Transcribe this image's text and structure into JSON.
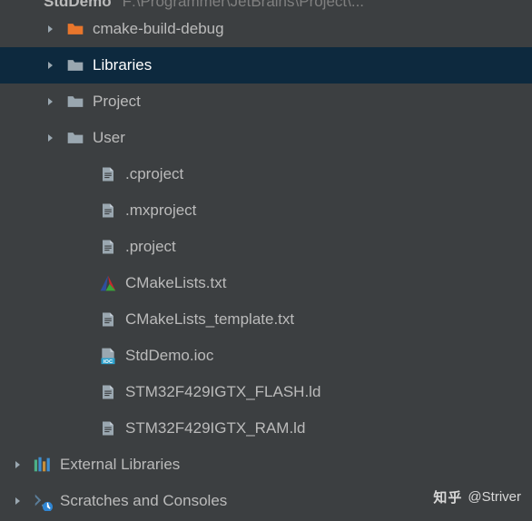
{
  "root": {
    "name": "StdDemo",
    "path": "F:\\Programmer\\JetBrains\\Project\\..."
  },
  "tree": [
    {
      "label": "cmake-build-debug",
      "icon": "folder-orange",
      "indent": 1,
      "chevron": true
    },
    {
      "label": "Libraries",
      "icon": "folder-gray",
      "indent": 1,
      "chevron": true,
      "selected": true
    },
    {
      "label": "Project",
      "icon": "folder-gray",
      "indent": 1,
      "chevron": true
    },
    {
      "label": "User",
      "icon": "folder-gray",
      "indent": 1,
      "chevron": true
    },
    {
      "label": ".cproject",
      "icon": "file-text",
      "indent": 2
    },
    {
      "label": ".mxproject",
      "icon": "file-text",
      "indent": 2
    },
    {
      "label": ".project",
      "icon": "file-text",
      "indent": 2
    },
    {
      "label": "CMakeLists.txt",
      "icon": "cmake",
      "indent": 2
    },
    {
      "label": "CMakeLists_template.txt",
      "icon": "file-text",
      "indent": 2
    },
    {
      "label": "StdDemo.ioc",
      "icon": "ioc",
      "indent": 2
    },
    {
      "label": "STM32F429IGTX_FLASH.ld",
      "icon": "file-text",
      "indent": 2
    },
    {
      "label": "STM32F429IGTX_RAM.ld",
      "icon": "file-text",
      "indent": 2
    },
    {
      "label": "External Libraries",
      "icon": "ext-lib",
      "indent": 0,
      "chevron": true
    },
    {
      "label": "Scratches and Consoles",
      "icon": "scratches",
      "indent": 0,
      "chevron": true
    }
  ],
  "watermark": {
    "site": "知乎",
    "user": "@Striver"
  }
}
